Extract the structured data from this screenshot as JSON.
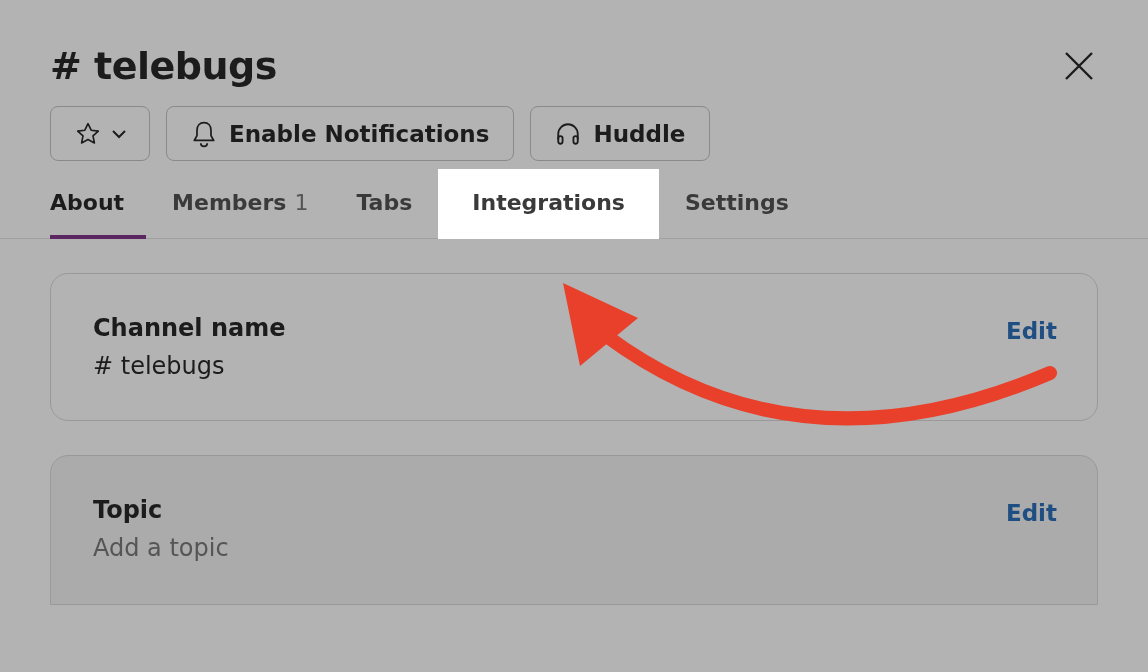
{
  "dialog": {
    "title": "# telebugs",
    "buttons": [
      {
        "kind": "star"
      },
      {
        "kind": "bell",
        "label": "Enable Notifications"
      },
      {
        "kind": "headphones",
        "label": "Huddle"
      }
    ],
    "tabs": [
      {
        "label": "About",
        "selected": true,
        "highlighted": false
      },
      {
        "label": "Members",
        "count": "1",
        "selected": false,
        "highlighted": false
      },
      {
        "label": "Tabs",
        "selected": false,
        "highlighted": false
      },
      {
        "label": "Integrations",
        "selected": false,
        "highlighted": true
      },
      {
        "label": "Settings",
        "selected": false,
        "highlighted": false
      }
    ],
    "sections": [
      {
        "title": "Channel name",
        "value": "# telebugs",
        "placeholder": false,
        "action": "Edit"
      },
      {
        "title": "Topic",
        "value": "Add a topic",
        "placeholder": true,
        "action": "Edit"
      }
    ]
  },
  "annotation": {
    "kind": "arrow"
  }
}
